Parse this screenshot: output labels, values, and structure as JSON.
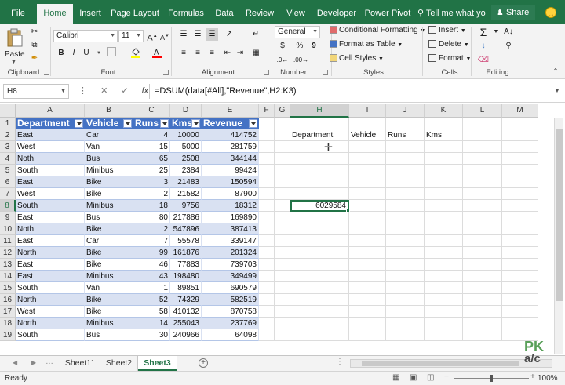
{
  "ribbon_tabs": [
    "File",
    "Home",
    "Insert",
    "Page Layout",
    "Formulas",
    "Data",
    "Review",
    "View",
    "Developer",
    "Power Pivot"
  ],
  "tell_me": "Tell me what yo",
  "share": "Share",
  "clipboard": {
    "paste": "Paste",
    "label": "Clipboard"
  },
  "font": {
    "name": "Calibri",
    "size": "11",
    "bold": "B",
    "italic": "I",
    "underline": "U",
    "label": "Font"
  },
  "alignment": {
    "label": "Alignment"
  },
  "number": {
    "format": "General",
    "currency": "$",
    "percent": "%",
    "comma": "9",
    "label": "Number"
  },
  "styles": {
    "conditional": "Conditional Formatting",
    "table": "Format as Table",
    "cell": "Cell Styles",
    "label": "Styles"
  },
  "cells": {
    "insert": "Insert",
    "delete": "Delete",
    "format": "Format",
    "label": "Cells"
  },
  "editing": {
    "label": "Editing"
  },
  "formula_bar": {
    "name_box": "H8",
    "formula": "=DSUM(data[#All],\"Revenue\",H2:K3)"
  },
  "columns": [
    "A",
    "B",
    "C",
    "D",
    "E",
    "F",
    "G",
    "H",
    "I",
    "J",
    "K",
    "L",
    "M"
  ],
  "rows": [
    "1",
    "2",
    "3",
    "4",
    "5",
    "6",
    "7",
    "8",
    "9",
    "10",
    "11",
    "12",
    "13",
    "14",
    "15",
    "16",
    "17",
    "18",
    "19"
  ],
  "table": {
    "headers": [
      "Department",
      "Vehicle",
      "Runs",
      "Kms",
      "Revenue"
    ],
    "rows": [
      [
        "East",
        "Car",
        "4",
        "10000",
        "414752"
      ],
      [
        "West",
        "Van",
        "15",
        "5000",
        "281759"
      ],
      [
        "Noth",
        "Bus",
        "65",
        "2508",
        "344144"
      ],
      [
        "South",
        "Minibus",
        "25",
        "2384",
        "99424"
      ],
      [
        "East",
        "Bike",
        "3",
        "21483",
        "150594"
      ],
      [
        "West",
        "Bike",
        "2",
        "21582",
        "87900"
      ],
      [
        "South",
        "Minibus",
        "18",
        "9756",
        "18312"
      ],
      [
        "East",
        "Bus",
        "80",
        "217886",
        "169890"
      ],
      [
        "Noth",
        "Bike",
        "2",
        "547896",
        "387413"
      ],
      [
        "East",
        "Car",
        "7",
        "55578",
        "339147"
      ],
      [
        "North",
        "Bike",
        "99",
        "161876",
        "201324"
      ],
      [
        "East",
        "Bike",
        "46",
        "77883",
        "739703"
      ],
      [
        "East",
        "Minibus",
        "43",
        "198480",
        "349499"
      ],
      [
        "South",
        "Van",
        "1",
        "89851",
        "690579"
      ],
      [
        "North",
        "Bike",
        "52",
        "74329",
        "582519"
      ],
      [
        "West",
        "Bike",
        "58",
        "410132",
        "870758"
      ],
      [
        "North",
        "Minibus",
        "14",
        "255043",
        "237769"
      ],
      [
        "South",
        "Bus",
        "30",
        "240966",
        "64098"
      ]
    ]
  },
  "criteria_headers": [
    "Department",
    "Vehicle",
    "Runs",
    "Kms"
  ],
  "result_value": "6029584",
  "sheets": [
    "Sheet11",
    "Sheet2",
    "Sheet3"
  ],
  "active_sheet": "Sheet3",
  "status": {
    "ready": "Ready",
    "zoom": "100%"
  },
  "watermark": {
    "line1": "PK",
    "line2": "a/c"
  },
  "colors": {
    "excel_green": "#217346",
    "table_header": "#4472c4",
    "table_band": "#d9e1f2"
  }
}
